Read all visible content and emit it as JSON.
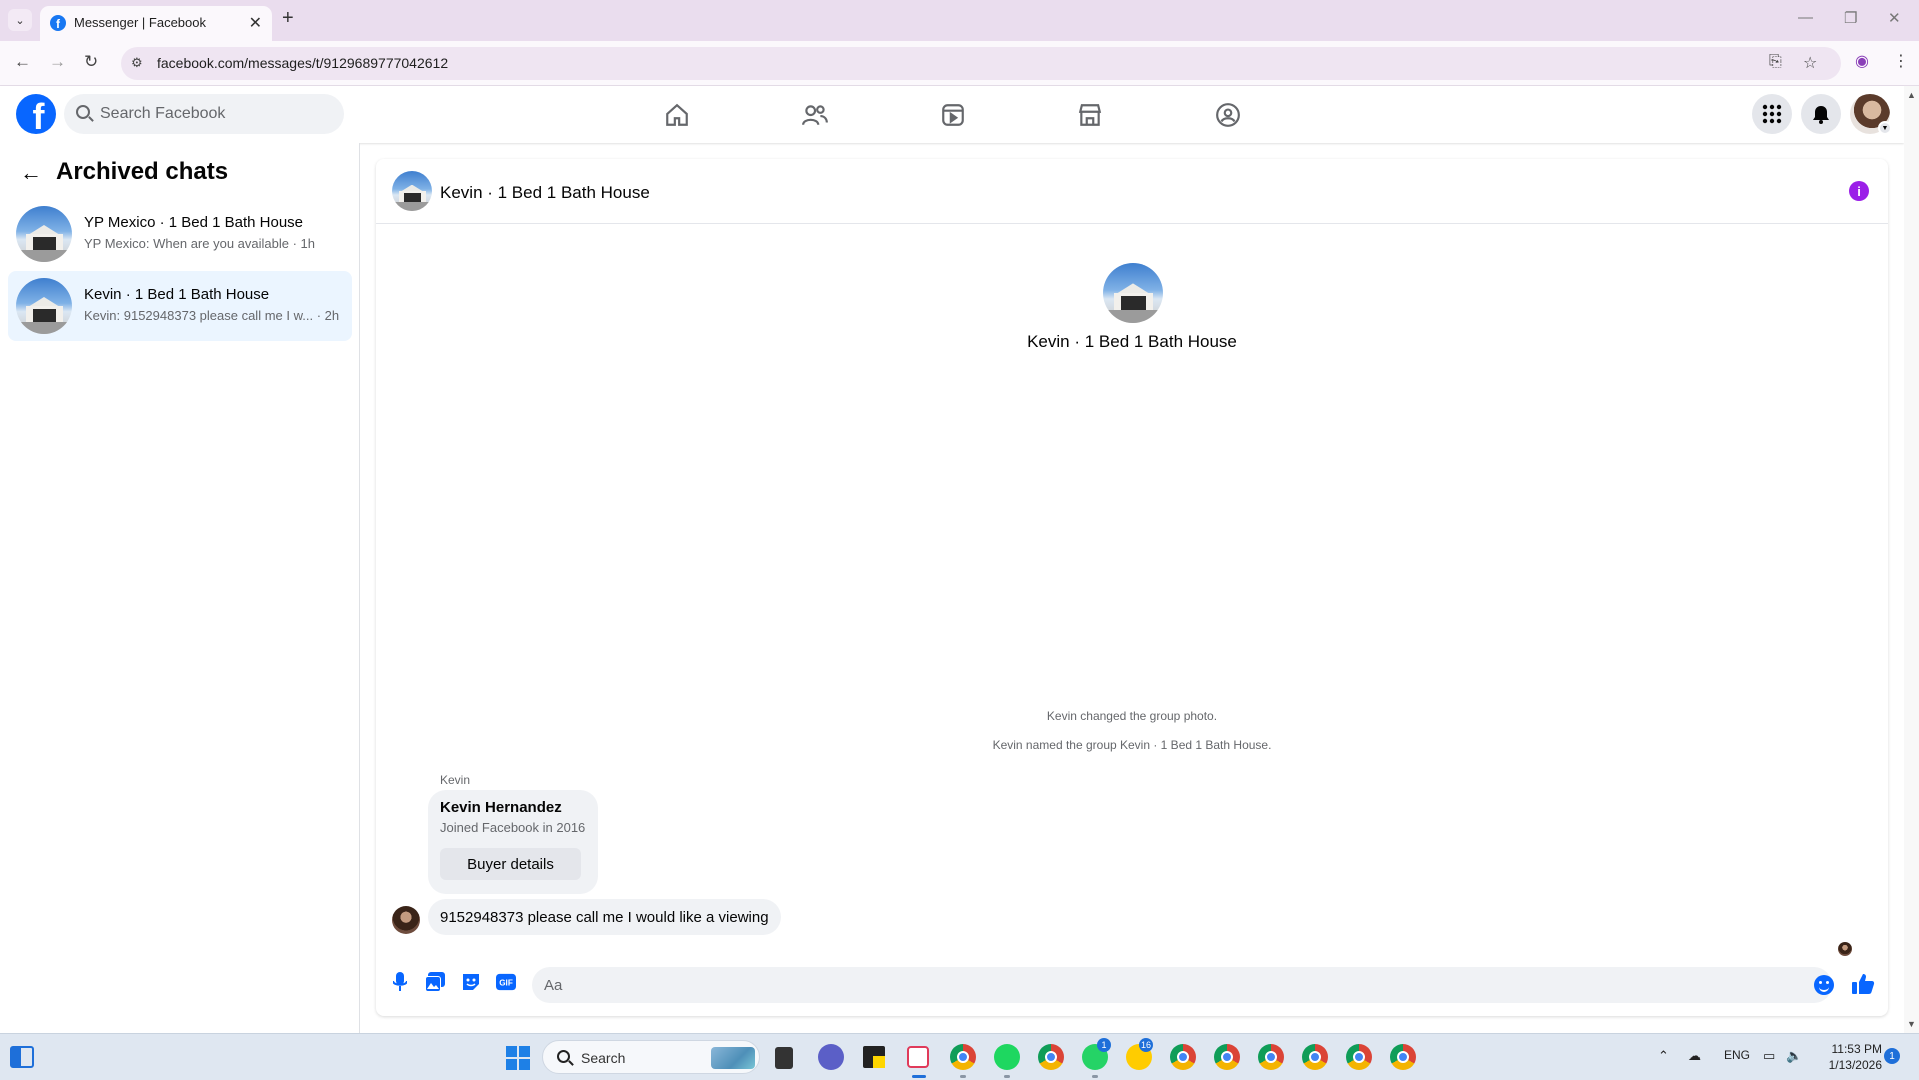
{
  "browser": {
    "tab_title": "Messenger | Facebook",
    "url": "facebook.com/messages/t/9129689777042612"
  },
  "facebook": {
    "logo_letter": "f",
    "search_placeholder": "Search Facebook",
    "nav_icons": [
      "home-icon",
      "friends-icon",
      "video-icon",
      "marketplace-icon",
      "groups-icon"
    ],
    "right_icons": [
      "menu-grid-icon",
      "notifications-bell-icon",
      "profile-avatar"
    ]
  },
  "sidebar": {
    "title": "Archived chats",
    "chats": [
      {
        "name": "YP Mexico · 1 Bed 1 Bath House",
        "preview": "YP Mexico: When are you available · 1h",
        "active": false
      },
      {
        "name": "Kevin · 1 Bed 1 Bath House",
        "preview": "Kevin: 9152948373 please call me I w...  · 2h",
        "active": true
      }
    ]
  },
  "conversation": {
    "title": "Kevin · 1 Bed 1 Bath House",
    "hero_name": "Kevin · 1 Bed 1 Bath House",
    "system_messages": [
      "Kevin changed the group photo.",
      "Kevin named the group Kevin · 1 Bed 1 Bath House."
    ],
    "sender_label": "Kevin",
    "buyer_card": {
      "name": "Kevin Hernandez",
      "subtitle": "Joined Facebook in 2016",
      "button": "Buyer details"
    },
    "message": "9152948373 please call me I would like a viewing",
    "composer_placeholder": "Aa",
    "accent_color": "#0866ff",
    "info_color": "#9b1fe8"
  },
  "taskbar": {
    "search_label": "Search",
    "badges": {
      "whatsapp": "1",
      "bell": "16"
    },
    "language": "ENG",
    "time": "11:53 PM",
    "date": "1/13/2026",
    "notification_count": "1"
  }
}
